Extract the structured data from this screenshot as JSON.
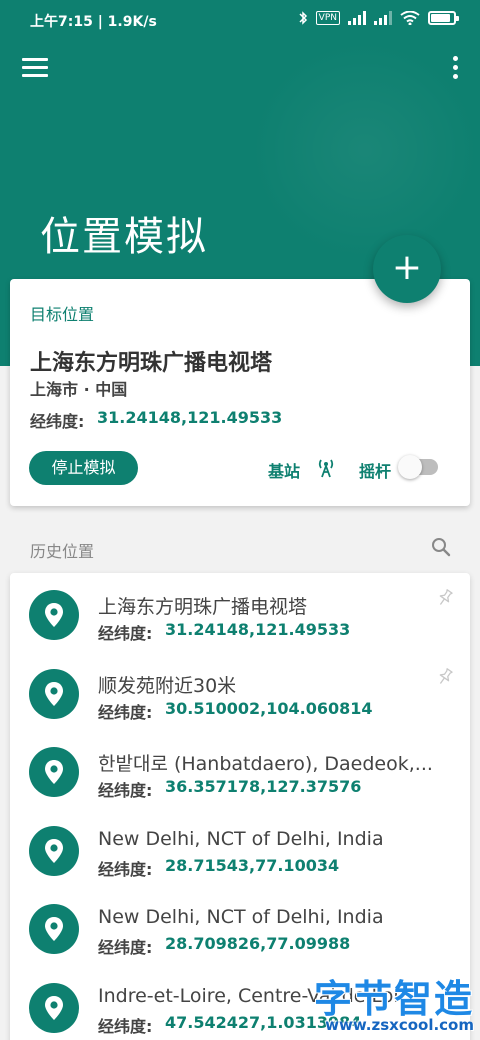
{
  "status_bar": {
    "time_speed": "上午7:15 | 1.9K/s",
    "vpn": "VPN",
    "battery_level": 0.85
  },
  "colors": {
    "primary": "#0e8070",
    "background": "#f2f2f2"
  },
  "header": {
    "title": "位置模拟",
    "fab_label": "+"
  },
  "target": {
    "section_label": "目标位置",
    "name": "上海东方明珠广播电视塔",
    "region": "上海市 · 中国",
    "coord_label": "经纬度:",
    "coord_value": "31.24148,121.49533",
    "stop_button": "停止模拟",
    "base_station_label": "基站",
    "joystick_label": "摇杆",
    "joystick_enabled": false
  },
  "history": {
    "title": "历史位置",
    "items": [
      {
        "name": "上海东方明珠广播电视塔",
        "coord_label": "经纬度:",
        "coord": "31.24148,121.49533",
        "pin_icon": "pin-icon"
      },
      {
        "name": "顺发苑附近30米",
        "coord_label": "经纬度:",
        "coord": "30.510002,104.060814",
        "pin_icon": "pin-icon"
      },
      {
        "name": "한밭대로 (Hanbatdaero), Daedeok,...",
        "coord_label": "经纬度:",
        "coord": "36.357178,127.37576"
      },
      {
        "name": "New Delhi, NCT of Delhi, India",
        "coord_label": "经纬度:",
        "coord": "28.71543,77.10034"
      },
      {
        "name": "New Delhi, NCT of Delhi, India",
        "coord_label": "经纬度:",
        "coord": "28.709826,77.09988"
      },
      {
        "name": "Indre-et-Loire, Centre-Val de Loi...",
        "coord_label": "经纬度:",
        "coord": "47.542427,1.0313984"
      }
    ]
  },
  "watermark": {
    "logo": "字节智造",
    "url": "www.zsxcool.com"
  }
}
